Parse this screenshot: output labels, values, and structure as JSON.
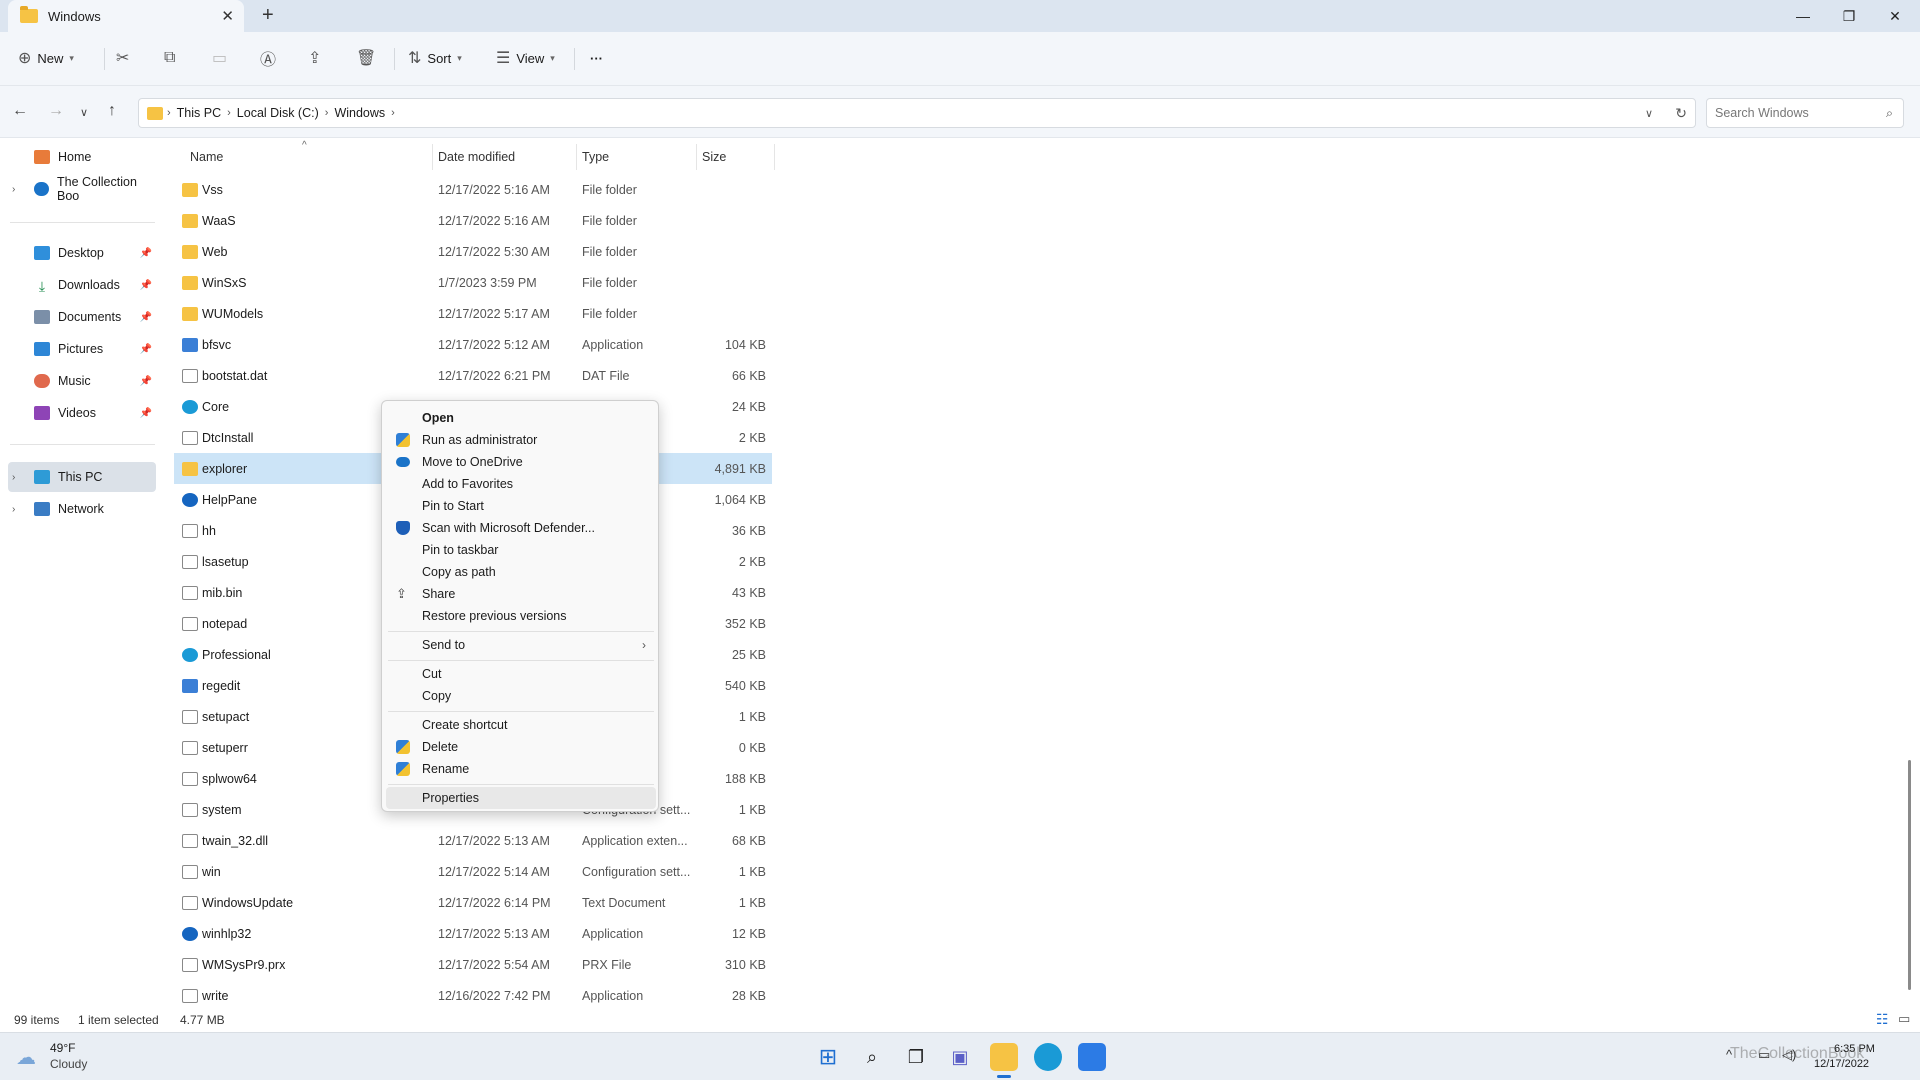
{
  "window": {
    "tab_title": "Windows",
    "tab_close": "✕",
    "new_tab": "+",
    "minimize": "—",
    "maximize": "❐",
    "close": "✕"
  },
  "commandbar": {
    "new_label": "New",
    "sort_label": "Sort",
    "view_label": "View",
    "more_label": "···"
  },
  "address": {
    "crumbs": [
      "This PC",
      "Local Disk (C:)",
      "Windows"
    ],
    "search_placeholder": "Search Windows"
  },
  "sidebar": {
    "home": "Home",
    "cloud": "The Collection Boo",
    "desktop": "Desktop",
    "downloads": "Downloads",
    "documents": "Documents",
    "pictures": "Pictures",
    "music": "Music",
    "videos": "Videos",
    "this_pc": "This PC",
    "network": "Network"
  },
  "columns": {
    "name": "Name",
    "date": "Date modified",
    "type": "Type",
    "size": "Size"
  },
  "files": [
    {
      "name": "Vss",
      "date": "12/17/2022 5:16 AM",
      "type": "File folder",
      "size": "",
      "icon": "folder"
    },
    {
      "name": "WaaS",
      "date": "12/17/2022 5:16 AM",
      "type": "File folder",
      "size": "",
      "icon": "folder"
    },
    {
      "name": "Web",
      "date": "12/17/2022 5:30 AM",
      "type": "File folder",
      "size": "",
      "icon": "folder"
    },
    {
      "name": "WinSxS",
      "date": "1/7/2023 3:59 PM",
      "type": "File folder",
      "size": "",
      "icon": "folder"
    },
    {
      "name": "WUModels",
      "date": "12/17/2022 5:17 AM",
      "type": "File folder",
      "size": "",
      "icon": "folder"
    },
    {
      "name": "bfsvc",
      "date": "12/17/2022 5:12 AM",
      "type": "Application",
      "size": "104 KB",
      "icon": "app"
    },
    {
      "name": "bootstat.dat",
      "date": "12/17/2022 6:21 PM",
      "type": "DAT File",
      "size": "66 KB",
      "icon": "doc"
    },
    {
      "name": "Core",
      "date": "",
      "type": "e H...",
      "size": "24 KB",
      "icon": "edge"
    },
    {
      "name": "DtcInstall",
      "date": "",
      "type": "t",
      "size": "2 KB",
      "icon": "doc"
    },
    {
      "name": "explorer",
      "date": "",
      "type": "",
      "size": "4,891 KB",
      "icon": "folder"
    },
    {
      "name": "HelpPane",
      "date": "",
      "type": "",
      "size": "1,064 KB",
      "icon": "help"
    },
    {
      "name": "hh",
      "date": "",
      "type": "",
      "size": "36 KB",
      "icon": "doc"
    },
    {
      "name": "lsasetup",
      "date": "",
      "type": "t",
      "size": "2 KB",
      "icon": "doc"
    },
    {
      "name": "mib.bin",
      "date": "",
      "type": "",
      "size": "43 KB",
      "icon": "doc"
    },
    {
      "name": "notepad",
      "date": "",
      "type": "",
      "size": "352 KB",
      "icon": "doc"
    },
    {
      "name": "Professional",
      "date": "",
      "type": "e H...",
      "size": "25 KB",
      "icon": "edge"
    },
    {
      "name": "regedit",
      "date": "",
      "type": "",
      "size": "540 KB",
      "icon": "app"
    },
    {
      "name": "setupact",
      "date": "",
      "type": "t",
      "size": "1 KB",
      "icon": "doc"
    },
    {
      "name": "setuperr",
      "date": "",
      "type": "t",
      "size": "0 KB",
      "icon": "doc"
    },
    {
      "name": "splwow64",
      "date": "",
      "type": "",
      "size": "188 KB",
      "icon": "doc"
    },
    {
      "name": "system",
      "date": "",
      "type": "Configuration sett...",
      "size": "1 KB",
      "icon": "doc"
    },
    {
      "name": "twain_32.dll",
      "date": "12/17/2022 5:13 AM",
      "type": "Application exten...",
      "size": "68 KB",
      "icon": "doc"
    },
    {
      "name": "win",
      "date": "12/17/2022 5:14 AM",
      "type": "Configuration sett...",
      "size": "1 KB",
      "icon": "doc"
    },
    {
      "name": "WindowsUpdate",
      "date": "12/17/2022 6:14 PM",
      "type": "Text Document",
      "size": "1 KB",
      "icon": "doc"
    },
    {
      "name": "winhlp32",
      "date": "12/17/2022 5:13 AM",
      "type": "Application",
      "size": "12 KB",
      "icon": "help"
    },
    {
      "name": "WMSysPr9.prx",
      "date": "12/17/2022 5:54 AM",
      "type": "PRX File",
      "size": "310 KB",
      "icon": "doc"
    },
    {
      "name": "write",
      "date": "12/16/2022 7:42 PM",
      "type": "Application",
      "size": "28 KB",
      "icon": "doc"
    }
  ],
  "context_menu": {
    "open": "Open",
    "run_admin": "Run as administrator",
    "onedrive": "Move to OneDrive",
    "favorites": "Add to Favorites",
    "pin_start": "Pin to Start",
    "defender": "Scan with Microsoft Defender...",
    "pin_taskbar": "Pin to taskbar",
    "copy_path": "Copy as path",
    "share": "Share",
    "restore": "Restore previous versions",
    "send_to": "Send to",
    "cut": "Cut",
    "copy": "Copy",
    "shortcut": "Create shortcut",
    "delete": "Delete",
    "rename": "Rename",
    "properties": "Properties"
  },
  "status": {
    "count": "99 items",
    "selected": "1 item selected",
    "size": "4.77 MB"
  },
  "taskbar": {
    "temp": "49°F",
    "condition": "Cloudy",
    "time": "6:35 PM",
    "date": "12/17/2022",
    "watermark": "TheCollectionBook"
  },
  "colors": {
    "accent": "#1f6fd1",
    "selection": "#cce4f7",
    "folder": "#f6c344"
  }
}
